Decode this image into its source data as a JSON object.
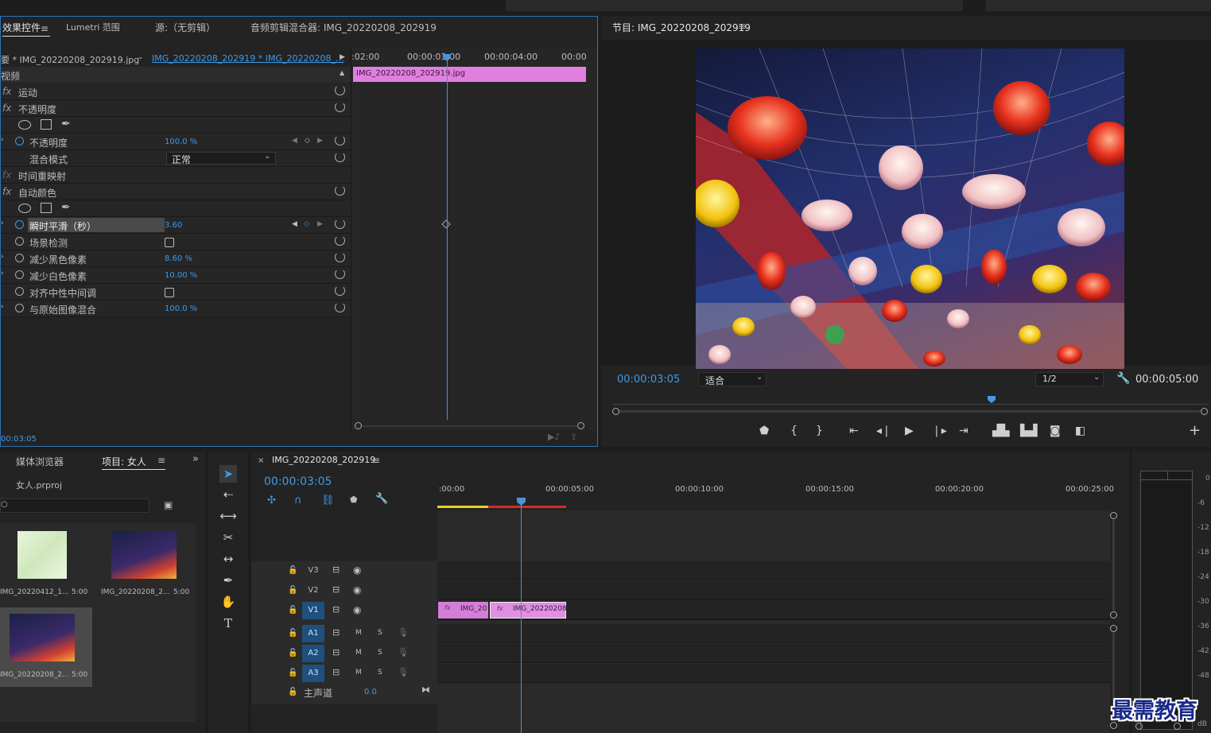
{
  "effect_controls": {
    "tabs": [
      "效果控件",
      "Lumetri 范围",
      "源:（无剪辑）",
      "音频剪辑混合器: IMG_20220208_202919"
    ],
    "master_clip": "要 * IMG_20220208_202919.jpg",
    "sequence_clip": "IMG_20220208_202919 * IMG_20220208_...",
    "section_video": "视频",
    "rows": {
      "motion": "运动",
      "opacity": "不透明度",
      "opacity_prop": "不透明度",
      "opacity_val": "100.0 %",
      "blend_mode": "混合模式",
      "blend_val": "正常",
      "time_remap": "时间重映射",
      "auto_color": "自动颜色",
      "smooth": "瞬时平滑（秒）",
      "smooth_val": "3.60",
      "scene_detect": "场景检测",
      "reduce_black": "减少黑色像素",
      "reduce_black_val": "8.60 %",
      "reduce_white": "减少白色像素",
      "reduce_white_val": "10.00 %",
      "snap_neutral": "对齐中性中间调",
      "blend_original": "与原始图像混合",
      "blend_original_val": "100.0 %"
    },
    "fx_label": "fx",
    "timecode": "00:03:05",
    "ruler": [
      ":02:00",
      "00:00:03:00",
      "00:00:04:00",
      "00:00"
    ],
    "clip_label": "IMG_20220208_202919.jpg"
  },
  "program": {
    "title": "节目: IMG_20220208_202919",
    "timecode": "00:00:03:05",
    "fit": "适合",
    "resolution": "1/2",
    "duration": "00:00:05:00"
  },
  "project": {
    "tab_media": "媒体浏览器",
    "tab_project": "项目: 女人",
    "file": "女人.prproj",
    "items": [
      {
        "name": "IMG_20220412_1...",
        "dur": "5:00"
      },
      {
        "name": "IMG_20220208_2...",
        "dur": "5:00"
      },
      {
        "name": "IMG_20220208_2...",
        "dur": "5:00"
      }
    ]
  },
  "timeline": {
    "title": "IMG_20220208_202919",
    "timecode": "00:00:03:05",
    "ruler": [
      ":00:00",
      "00:00:05:00",
      "00:00:10:00",
      "00:00:15:00",
      "00:00:20:00",
      "00:00:25:00"
    ],
    "tracks": [
      "V3",
      "V2",
      "V1",
      "A1",
      "A2",
      "A3"
    ],
    "mute": "M",
    "solo": "S",
    "master": "主声道",
    "master_val": "0.0",
    "clip1": "IMG_20",
    "clip2": "IMG_20220208"
  },
  "meter": {
    "ticks": [
      "0",
      "-6",
      "-12",
      "-18",
      "-24",
      "-30",
      "-36",
      "-42",
      "-48",
      "dB"
    ]
  },
  "watermark": "最需教育"
}
